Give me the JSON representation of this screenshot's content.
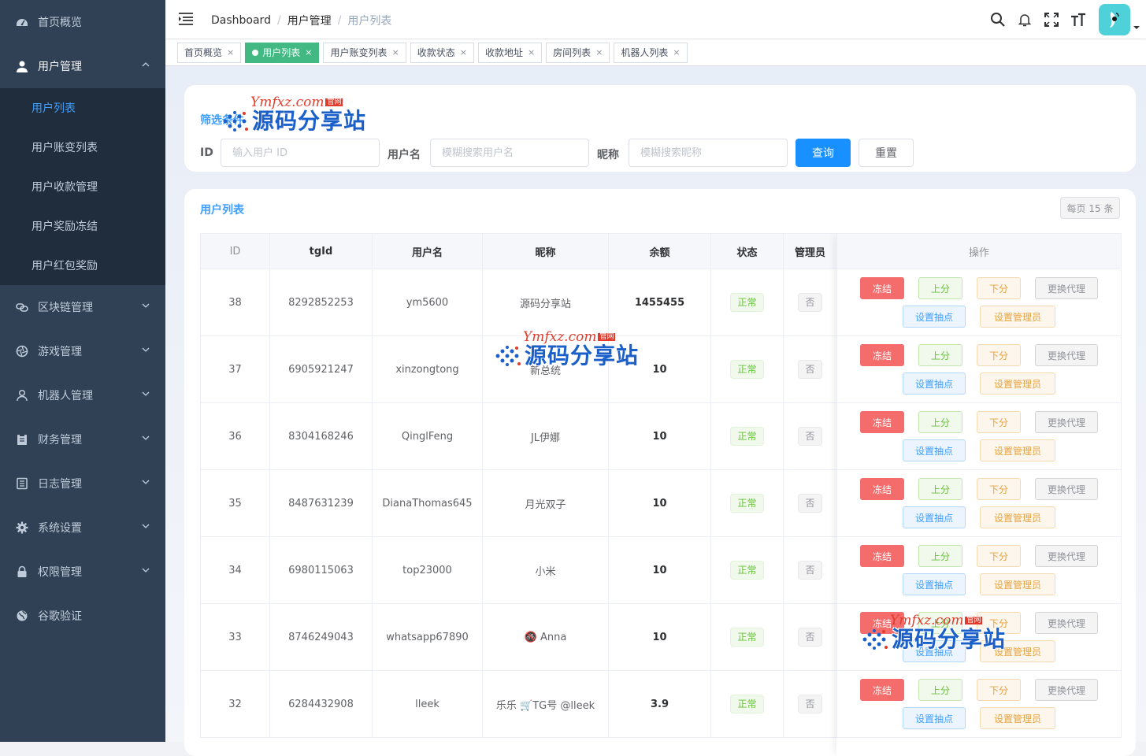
{
  "sidebar": {
    "items": [
      {
        "label": "首页概览",
        "icon": "dashboard-icon"
      },
      {
        "label": "用户管理",
        "icon": "user-icon",
        "open": true,
        "children": [
          "用户列表",
          "用户账变列表",
          "用户收款管理",
          "用户奖励冻结",
          "用户红包奖励"
        ]
      },
      {
        "label": "区块链管理",
        "icon": "chain-icon"
      },
      {
        "label": "游戏管理",
        "icon": "aperture-icon"
      },
      {
        "label": "机器人管理",
        "icon": "person-outline-icon"
      },
      {
        "label": "财务管理",
        "icon": "clipboard-icon"
      },
      {
        "label": "日志管理",
        "icon": "document-icon"
      },
      {
        "label": "系统设置",
        "icon": "gear-icon"
      },
      {
        "label": "权限管理",
        "icon": "lock-icon"
      },
      {
        "label": "谷歌验证",
        "icon": "globe-icon"
      }
    ]
  },
  "header": {
    "breadcrumb": [
      "Dashboard",
      "用户管理",
      "用户列表"
    ]
  },
  "tags": [
    {
      "label": "首页概览",
      "active": false
    },
    {
      "label": "用户列表",
      "active": true
    },
    {
      "label": "用户账变列表",
      "active": false
    },
    {
      "label": "收款状态",
      "active": false
    },
    {
      "label": "收款地址",
      "active": false
    },
    {
      "label": "房间列表",
      "active": false
    },
    {
      "label": "机器人列表",
      "active": false
    }
  ],
  "tag_close": "×",
  "filter": {
    "title": "筛选条件",
    "id_label": "ID",
    "id_placeholder": "输入用户 ID",
    "username_label": "用户名",
    "username_placeholder": "模糊搜索用户名",
    "nickname_label": "昵称",
    "nickname_placeholder": "模糊搜索昵称",
    "query_label": "查询",
    "reset_label": "重置"
  },
  "list": {
    "title": "用户列表",
    "per_page": "每页 15 条",
    "columns": [
      "ID",
      "tgId",
      "用户名",
      "昵称",
      "余额",
      "状态",
      "管理员",
      "操作"
    ],
    "rows": [
      {
        "id": "38",
        "tgid": "8292852253",
        "username": "ym5600",
        "nickname": "源码分享站",
        "balance": "1455455",
        "status": "正常",
        "admin": "否"
      },
      {
        "id": "37",
        "tgid": "6905921247",
        "username": "xinzongtong",
        "nickname": "新总统",
        "balance": "10",
        "status": "正常",
        "admin": "否"
      },
      {
        "id": "36",
        "tgid": "8304168246",
        "username": "QinglFeng",
        "nickname": "JL伊娜",
        "balance": "10",
        "status": "正常",
        "admin": "否"
      },
      {
        "id": "35",
        "tgid": "8487631239",
        "username": "DianaThomas645",
        "nickname": "月光双子",
        "balance": "10",
        "status": "正常",
        "admin": "否"
      },
      {
        "id": "34",
        "tgid": "6980115063",
        "username": "top23000",
        "nickname": "小米",
        "balance": "10",
        "status": "正常",
        "admin": "否"
      },
      {
        "id": "33",
        "tgid": "8746249043",
        "username": "whatsapp67890",
        "nickname": "🚳 Anna",
        "balance": "10",
        "status": "正常",
        "admin": "否"
      },
      {
        "id": "32",
        "tgid": "6284432908",
        "username": "lleek",
        "nickname": "乐乐 🛒TG号 @lleek",
        "balance": "3.9",
        "status": "正常",
        "admin": "否"
      }
    ],
    "actions": {
      "freeze": "冻结",
      "credit": "上分",
      "debit": "下分",
      "change_agent": "更换代理",
      "set_rake": "设置抽点",
      "set_admin": "设置管理员"
    }
  },
  "watermark": {
    "site": "Ymfxz.com",
    "badge": "官网",
    "brand": "源码分享站"
  },
  "colors": {
    "sidebar_bg": "#304156",
    "submenu_bg": "#1f2d3d",
    "primary": "#409eff",
    "tag_active": "#42b983",
    "danger": "#f56c6c",
    "success": "#67c23a",
    "warning": "#e6a23c",
    "avatar_bg": "#4fd1d9"
  }
}
